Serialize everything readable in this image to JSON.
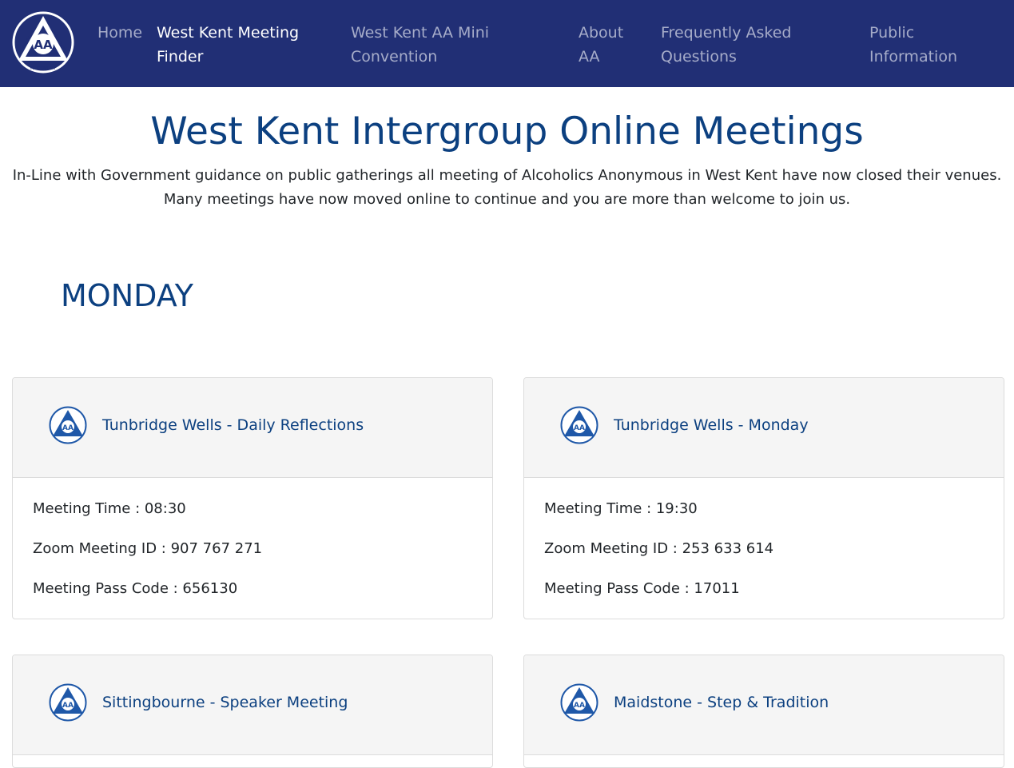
{
  "colors": {
    "navbar": "#212f75",
    "nav_active": "#ffffff",
    "nav_inactive": "#a6acc9",
    "heading": "#0c4080",
    "card_header": "#f5f5f5"
  },
  "logo": {
    "icon": "aa-logo-icon",
    "text_center": "AA",
    "text_left": "UNITY",
    "text_right": "SERVICE",
    "text_bottom": "RECOVERY"
  },
  "nav": {
    "items": [
      {
        "label": "Home",
        "active": false
      },
      {
        "label": "West Kent Meeting Finder",
        "active": true
      },
      {
        "label": "West Kent AA Mini Convention",
        "active": false
      },
      {
        "label": "About AA",
        "active": false
      },
      {
        "label": "Frequently Asked Questions",
        "active": false
      },
      {
        "label": "Public Information",
        "active": false
      }
    ]
  },
  "hero": {
    "title": "West Kent Intergroup Online Meetings",
    "line1": "In-Line with Government guidance on public gatherings all meeting of Alcoholics Anonymous in West Kent have now closed their venues.",
    "line2": "Many meetings have now moved online to continue and you are more than welcome to join us."
  },
  "day": "MONDAY",
  "meetings": [
    {
      "name": "Tunbridge Wells - Daily Reflections",
      "time": "Meeting Time : 08:30",
      "zoom_id": "Zoom Meeting ID : 907 767 271",
      "pass_code": "Meeting Pass Code : 656130"
    },
    {
      "name": "Tunbridge Wells - Monday",
      "time": "Meeting Time : 19:30",
      "zoom_id": "Zoom Meeting ID : 253 633 614",
      "pass_code": "Meeting Pass Code : 17011"
    },
    {
      "name": "Sittingbourne - Speaker Meeting"
    },
    {
      "name": "Maidstone - Step & Tradition"
    }
  ]
}
